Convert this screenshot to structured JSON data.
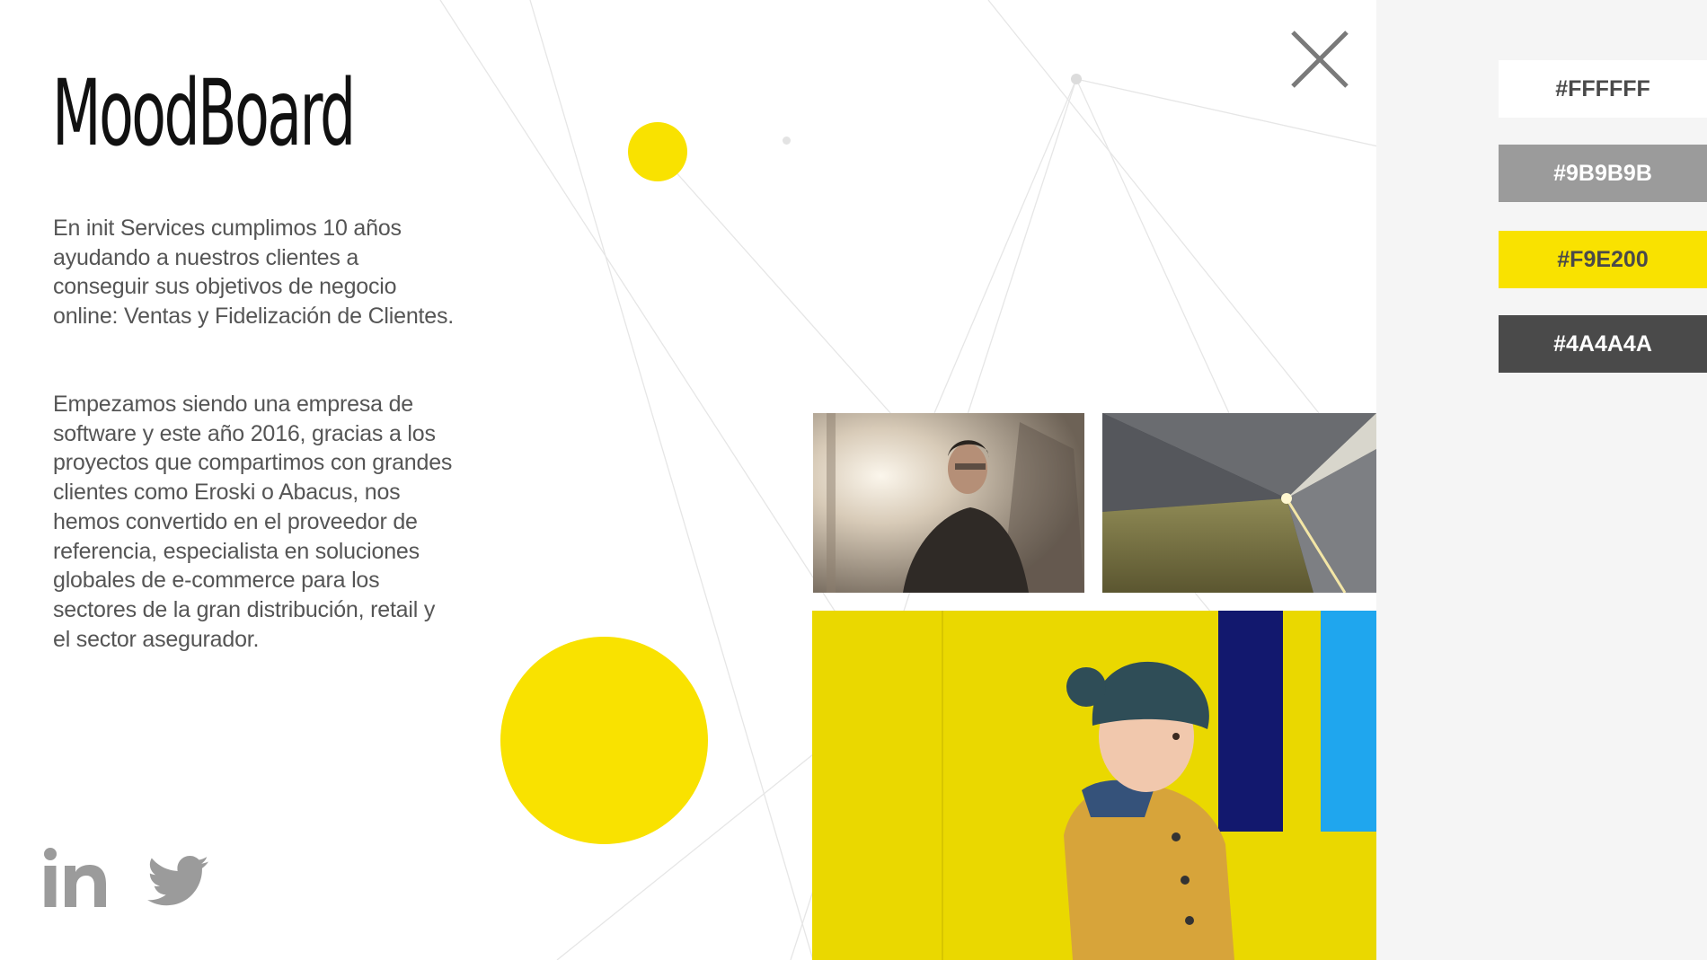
{
  "title": "MoodBoard",
  "intro": {
    "paragraph_1": "En init Services cumplimos 10 años ayudando a nuestros clientes a conseguir sus objetivos de negocio online: Ventas y Fidelización de Clientes.",
    "paragraph_2": "Empezamos siendo una empresa de software y este año 2016, gracias a los proyectos que compartimos con grandes clientes como Eroski o Abacus, nos hemos convertido en el proveedor de referencia, especialista en soluciones globales de e-commerce para los sectores de la gran distribución, retail y el sector asegurador."
  },
  "palette": [
    {
      "label": "#FFFFFF",
      "color": "#FFFFFF"
    },
    {
      "label": "#9B9B9B",
      "color": "#9B9B9B"
    },
    {
      "label": "#F9E200",
      "color": "#F9E200"
    },
    {
      "label": "#4A4A4A",
      "color": "#4A4A4A"
    }
  ],
  "colors": {
    "accent_yellow": "#F9E200",
    "text_gray": "#4A4A4A",
    "icon_gray": "#9B9B9B",
    "sidebar_bg": "#F5F5F5"
  },
  "icons": {
    "close": "close-icon",
    "linkedin": "linkedin-icon",
    "twitter": "twitter-icon"
  },
  "photos": [
    {
      "subject": "man-in-sunlight-photo"
    },
    {
      "subject": "subway-platform-photo"
    },
    {
      "subject": "child-yellow-wall-photo"
    }
  ]
}
